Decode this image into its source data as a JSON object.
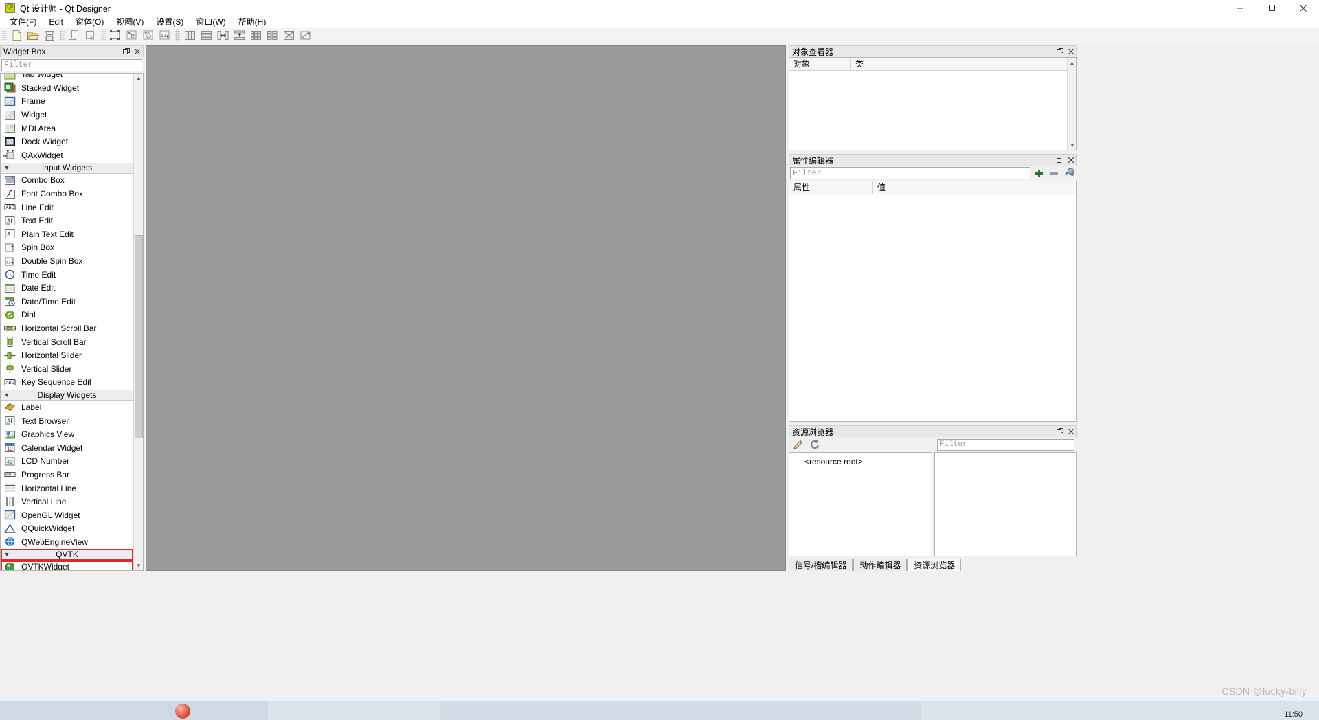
{
  "window": {
    "title": "Qt 设计师 - Qt Designer",
    "app_icon": "qt-logo-icon",
    "buttons": {
      "minimize": "minimize-icon",
      "maximize": "maximize-icon",
      "close": "close-icon"
    }
  },
  "menubar": {
    "items": [
      {
        "label": "文件(F)"
      },
      {
        "label": "Edit"
      },
      {
        "label": "窗体(O)"
      },
      {
        "label": "视图(V)"
      },
      {
        "label": "设置(S)"
      },
      {
        "label": "窗口(W)"
      },
      {
        "label": "帮助(H)"
      }
    ]
  },
  "toolbar": {
    "groups": [
      {
        "buttons": [
          {
            "name": "new-form-button",
            "icon": "new-file-icon"
          },
          {
            "name": "open-form-button",
            "icon": "open-folder-icon"
          },
          {
            "name": "save-form-button",
            "icon": "floppy-save-icon"
          }
        ]
      },
      {
        "buttons": [
          {
            "name": "undo-button",
            "icon": "copy-pages-icon"
          },
          {
            "name": "redo-button",
            "icon": "paste-page-icon"
          }
        ]
      },
      {
        "buttons": [
          {
            "name": "edit-widgets-button",
            "icon": "edit-widgets-icon"
          },
          {
            "name": "edit-signals-slots-button",
            "icon": "signals-slots-icon"
          },
          {
            "name": "edit-buddies-button",
            "icon": "buddies-icon"
          },
          {
            "name": "edit-tab-order-button",
            "icon": "tab-order-123-icon"
          }
        ]
      },
      {
        "buttons": [
          {
            "name": "layout-horizontally-button",
            "icon": "layout-horizontal-icon"
          },
          {
            "name": "layout-vertically-button",
            "icon": "layout-vertical-icon"
          },
          {
            "name": "layout-splitter-horizontal-button",
            "icon": "splitter-horizontal-icon"
          },
          {
            "name": "layout-splitter-vertical-button",
            "icon": "splitter-vertical-icon"
          },
          {
            "name": "layout-grid-button",
            "icon": "layout-grid-icon"
          },
          {
            "name": "layout-form-button",
            "icon": "layout-form-icon"
          },
          {
            "name": "break-layout-button",
            "icon": "break-layout-icon"
          },
          {
            "name": "adjust-size-button",
            "icon": "adjust-size-icon"
          }
        ]
      }
    ]
  },
  "widget_box": {
    "title": "Widget Box",
    "float_icon": "undock-icon",
    "close_icon": "close-icon",
    "filter_placeholder": "Filter",
    "filter_value": "",
    "groups": [
      {
        "name": "containers-partial",
        "label": "",
        "collapsed": false,
        "items": [
          {
            "label": "Tab Widget",
            "icon": "tab-widget-icon",
            "clipped": true
          },
          {
            "label": "Stacked Widget",
            "icon": "stacked-widget-icon"
          },
          {
            "label": "Frame",
            "icon": "frame-icon"
          },
          {
            "label": "Widget",
            "icon": "widget-icon"
          },
          {
            "label": "MDI Area",
            "icon": "mdi-area-icon"
          },
          {
            "label": "Dock Widget",
            "icon": "dock-widget-icon"
          },
          {
            "label": "QAxWidget",
            "icon": "qaxwidget-icon"
          }
        ]
      },
      {
        "name": "input-widgets",
        "label": "Input Widgets",
        "collapsed": false,
        "items": [
          {
            "label": "Combo Box",
            "icon": "combo-box-icon"
          },
          {
            "label": "Font Combo Box",
            "icon": "font-combo-box-icon"
          },
          {
            "label": "Line Edit",
            "icon": "line-edit-icon"
          },
          {
            "label": "Text Edit",
            "icon": "text-edit-icon"
          },
          {
            "label": "Plain Text Edit",
            "icon": "plain-text-edit-icon"
          },
          {
            "label": "Spin Box",
            "icon": "spin-box-icon"
          },
          {
            "label": "Double Spin Box",
            "icon": "double-spin-box-icon"
          },
          {
            "label": "Time Edit",
            "icon": "time-edit-icon"
          },
          {
            "label": "Date Edit",
            "icon": "date-edit-icon"
          },
          {
            "label": "Date/Time Edit",
            "icon": "date-time-edit-icon"
          },
          {
            "label": "Dial",
            "icon": "dial-icon"
          },
          {
            "label": "Horizontal Scroll Bar",
            "icon": "horizontal-scroll-bar-icon"
          },
          {
            "label": "Vertical Scroll Bar",
            "icon": "vertical-scroll-bar-icon"
          },
          {
            "label": "Horizontal Slider",
            "icon": "horizontal-slider-icon"
          },
          {
            "label": "Vertical Slider",
            "icon": "vertical-slider-icon"
          },
          {
            "label": "Key Sequence Edit",
            "icon": "key-sequence-edit-icon"
          }
        ]
      },
      {
        "name": "display-widgets",
        "label": "Display Widgets",
        "collapsed": false,
        "items": [
          {
            "label": "Label",
            "icon": "label-icon"
          },
          {
            "label": "Text Browser",
            "icon": "text-browser-icon"
          },
          {
            "label": "Graphics View",
            "icon": "graphics-view-icon"
          },
          {
            "label": "Calendar Widget",
            "icon": "calendar-widget-icon"
          },
          {
            "label": "LCD Number",
            "icon": "lcd-number-icon"
          },
          {
            "label": "Progress Bar",
            "icon": "progress-bar-icon"
          },
          {
            "label": "Horizontal Line",
            "icon": "horizontal-line-icon"
          },
          {
            "label": "Vertical Line",
            "icon": "vertical-line-icon"
          },
          {
            "label": "OpenGL Widget",
            "icon": "opengl-widget-icon"
          },
          {
            "label": "QQuickWidget",
            "icon": "qquickwidget-icon"
          },
          {
            "label": "QWebEngineView",
            "icon": "qwebengineview-icon"
          }
        ]
      },
      {
        "name": "qvtk",
        "label": "QVTK",
        "collapsed": false,
        "highlighted": true,
        "items": [
          {
            "label": "QVTKWidget",
            "icon": "qvtkwidget-icon",
            "highlighted": true
          }
        ]
      }
    ],
    "highlight_color": "#e8262a"
  },
  "object_inspector": {
    "title": "对象查看器",
    "float_icon": "undock-icon",
    "close_icon": "close-icon",
    "columns": [
      "对象",
      "类"
    ],
    "rows": []
  },
  "property_editor": {
    "title": "属性编辑器",
    "float_icon": "undock-icon",
    "close_icon": "close-icon",
    "filter_placeholder": "Filter",
    "filter_value": "",
    "buttons": [
      {
        "name": "add-dynamic-property-button",
        "icon": "plus-icon"
      },
      {
        "name": "remove-dynamic-property-button",
        "icon": "minus-icon"
      },
      {
        "name": "configure-property-editor-button",
        "icon": "wrench-icon"
      }
    ],
    "columns": [
      "属性",
      "值"
    ],
    "rows": []
  },
  "resource_browser": {
    "title": "资源浏览器",
    "float_icon": "undock-icon",
    "close_icon": "close-icon",
    "buttons": [
      {
        "name": "edit-resources-button",
        "icon": "pencil-icon"
      },
      {
        "name": "reload-resources-button",
        "icon": "reload-icon"
      }
    ],
    "filter_placeholder": "Filter",
    "filter_value": "",
    "tree_root": "<resource root>"
  },
  "bottom_tabs": {
    "tabs": [
      {
        "label": "信号/槽编辑器",
        "active": false
      },
      {
        "label": "动作编辑器",
        "active": false
      },
      {
        "label": "资源浏览器",
        "active": true
      }
    ]
  },
  "status": {
    "watermark": "CSDN @lucky-billy",
    "clock": "11:50"
  },
  "colors": {
    "canvas": "#9b9b9b",
    "chrome": "#f0f0f0",
    "dock_title": "#e8e8e8",
    "accent_red": "#e8262a",
    "taskbar": "#d9e3ec"
  }
}
